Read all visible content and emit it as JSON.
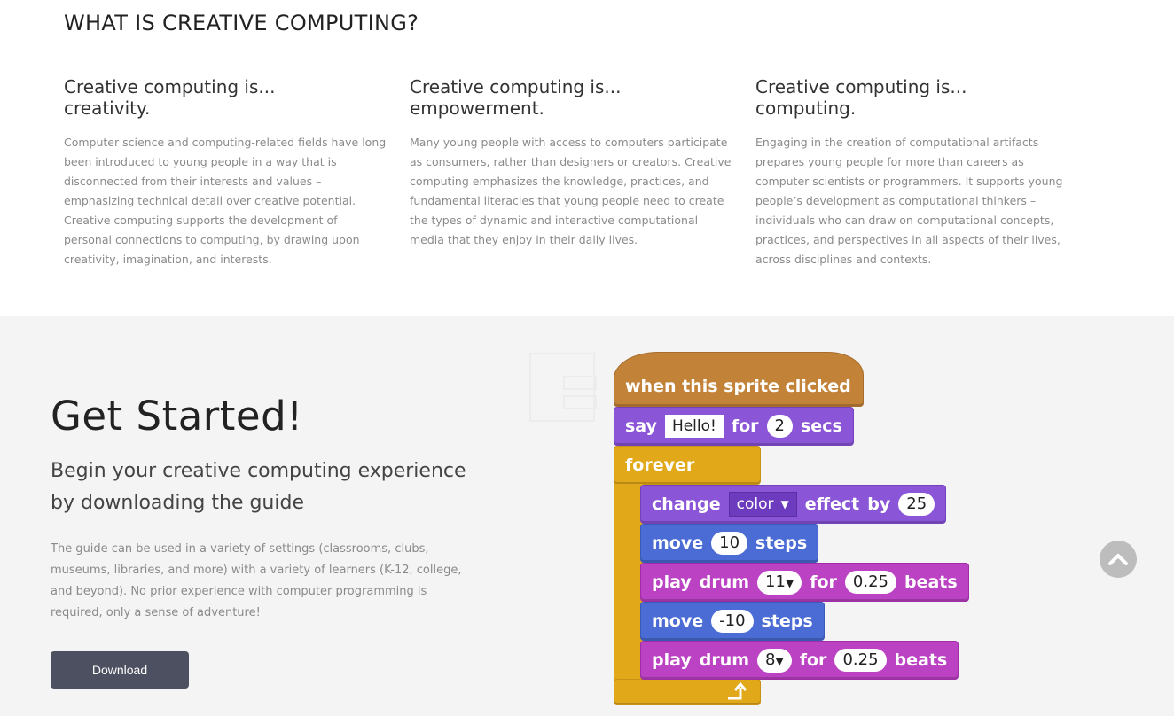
{
  "what_is": {
    "title": "WHAT IS CREATIVE COMPUTING?",
    "columns": [
      {
        "heading_line1": "Creative computing is...",
        "heading_line2": "creativity.",
        "body": "Computer science and computing-related fields have long been introduced to young people in a way that is disconnected from their interests and values – emphasizing technical detail over creative potential. Creative computing supports the development of personal connections to computing, by drawing upon creativity, imagination, and interests."
      },
      {
        "heading_line1": "Creative computing is...",
        "heading_line2": "empowerment.",
        "body": "Many young people with access to computers participate as consumers, rather than designers or creators. Creative computing emphasizes the knowledge, practices, and fundamental literacies that young people need to create the types of dynamic and interactive computational media that they enjoy in their daily lives."
      },
      {
        "heading_line1": "Creative computing is...",
        "heading_line2": "computing.",
        "body": "Engaging in the creation of computational artifacts prepares young people for more than careers as computer scientists or programmers. It supports young people’s development as computational thinkers – individuals who can draw on computational concepts, practices, and perspectives in all aspects of their lives, across disciplines and contexts."
      }
    ]
  },
  "get_started": {
    "title": "Get Started!",
    "subtitle": "Begin your creative computing experience by downloading the guide",
    "body": "The guide can be used in a variety of settings (classrooms, clubs, museums, libraries, and more) with a variety of learners (K-12, college, and beyond). No prior experience with computer programming is required, only a sense of adventure!",
    "download_label": "Download"
  },
  "script": {
    "hat": "when this sprite clicked",
    "say": {
      "word": "say",
      "text": "Hello!",
      "for": "for",
      "secs_value": "2",
      "secs": "secs"
    },
    "forever": "forever",
    "change": {
      "word": "change",
      "effect_option": "color",
      "effect": "effect",
      "by": "by",
      "value": "25"
    },
    "move1": {
      "word": "move",
      "value": "10",
      "steps": "steps"
    },
    "drum1": {
      "play": "play",
      "drum": "drum",
      "drum_value": "11",
      "for": "for",
      "beats_value": "0.25",
      "beats": "beats"
    },
    "move2": {
      "word": "move",
      "value": "-10",
      "steps": "steps"
    },
    "drum2": {
      "play": "play",
      "drum": "drum",
      "drum_value": "8",
      "for": "for",
      "beats_value": "0.25",
      "beats": "beats"
    }
  },
  "icons": {
    "scroll_top": "chevron-up-icon",
    "dropdown": "triangle-down-icon",
    "loop_arrow": "loop-arrow-icon"
  },
  "colors": {
    "events": "#c28238",
    "looks": "#8a55d7",
    "motion": "#4a6cd4",
    "sound": "#bb42c3",
    "control": "#e1a91a",
    "button": "#4d5060"
  }
}
